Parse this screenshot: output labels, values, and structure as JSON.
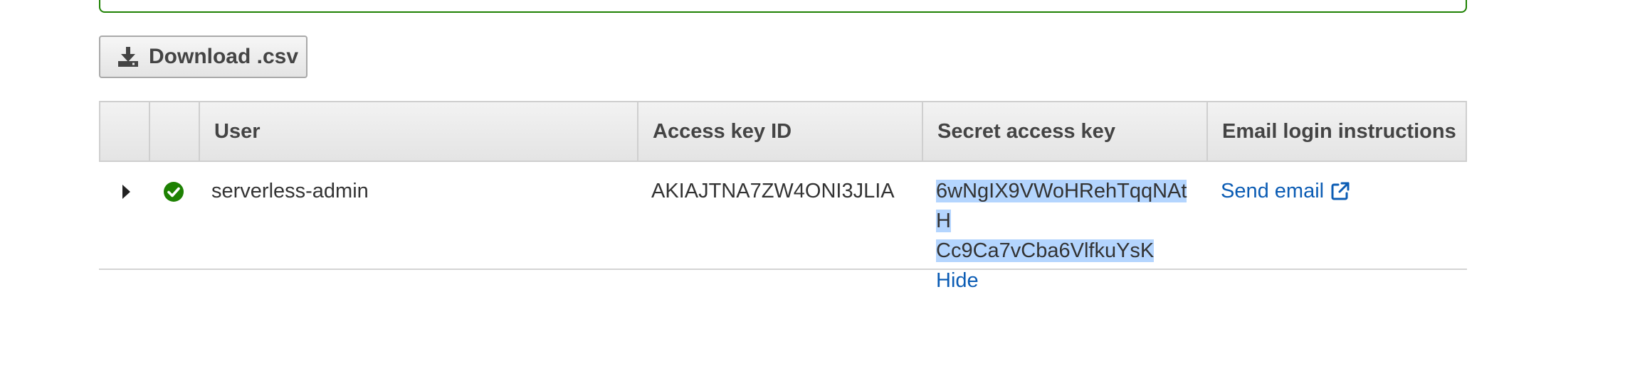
{
  "toolbar": {
    "download_label": "Download .csv"
  },
  "table": {
    "headers": {
      "user": "User",
      "access_key_id": "Access key ID",
      "secret_access_key": "Secret access key",
      "email_login": "Email login instructions"
    },
    "rows": [
      {
        "user": "serverless-admin",
        "access_key_id": "AKIAJTNA7ZW4ONI3JLIA",
        "secret_line1": "6wNgIX9VWoHRehTqqNAtH",
        "secret_line2": "Cc9Ca7vCba6VlfkuYsK",
        "hide_label": "Hide",
        "send_email_label": "Send email",
        "status": "success"
      }
    ]
  },
  "colors": {
    "success": "#1d8102",
    "link": "#0b5cb4",
    "selection": "#b4d5fe"
  },
  "icons": {
    "download": "download-icon",
    "status": "check-circle-icon",
    "expand": "caret-right-icon",
    "external": "external-link-icon"
  }
}
